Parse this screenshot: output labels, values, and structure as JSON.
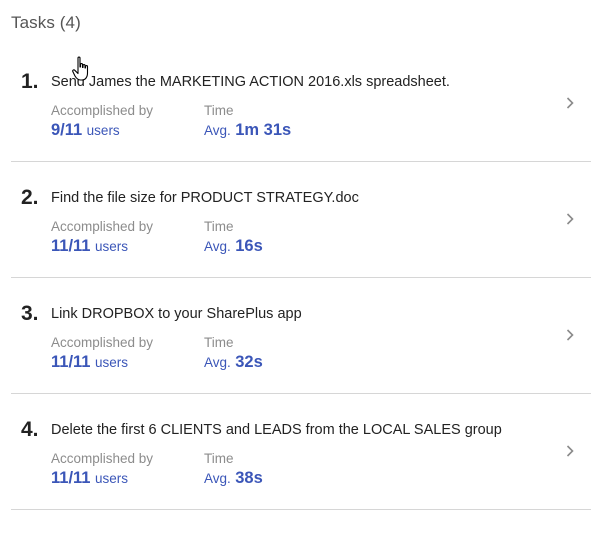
{
  "header": {
    "title": "Tasks (4)"
  },
  "labels": {
    "accomplished_by": "Accomplished by",
    "time": "Time",
    "users": "users",
    "avg": "Avg."
  },
  "tasks": [
    {
      "number": "1.",
      "title": "Send James the MARKETING ACTION 2016.xls spreadsheet.",
      "accomplished": "9/11",
      "avg_time": "1m 31s"
    },
    {
      "number": "2.",
      "title": "Find the file size for PRODUCT STRATEGY.doc",
      "accomplished": "11/11",
      "avg_time": "16s"
    },
    {
      "number": "3.",
      "title": "Link DROPBOX to your SharePlus app",
      "accomplished": "11/11",
      "avg_time": "32s"
    },
    {
      "number": "4.",
      "title": "Delete the first 6 CLIENTS and LEADS from the LOCAL SALES group",
      "accomplished": "11/11",
      "avg_time": "38s"
    }
  ],
  "colors": {
    "accent": "#3b56b8",
    "label": "#8c8c8c",
    "divider": "#d6d6d6"
  },
  "icons": {
    "row_action": "chevron-right-icon",
    "cursor": "hand-pointer-cursor-icon"
  }
}
